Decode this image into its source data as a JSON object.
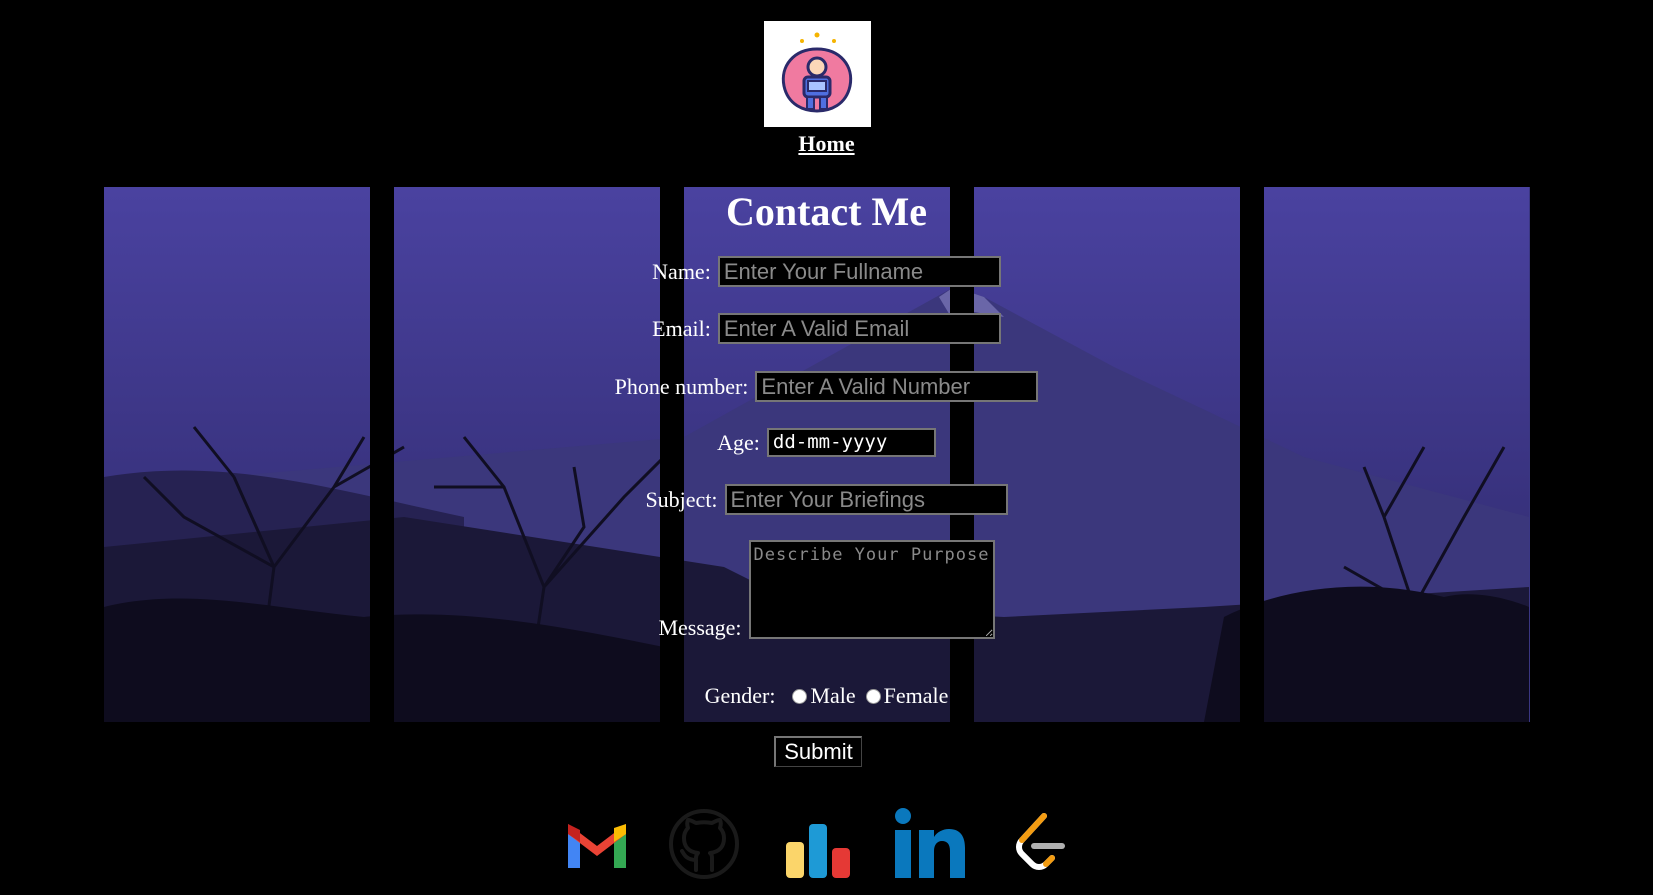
{
  "header": {
    "home_label": "Home",
    "logo_icon": "developer-avatar-icon"
  },
  "form": {
    "title": "Contact Me",
    "name_label": "Name:",
    "name_placeholder": "Enter Your Fullname",
    "email_label": "Email:",
    "email_placeholder": "Enter A Valid Email",
    "phone_label": "Phone number:",
    "phone_placeholder": "Enter A Valid Number",
    "age_label": "Age:",
    "age_value": "dd-mm-yyyy",
    "subject_label": "Subject:",
    "subject_placeholder": "Enter Your Briefings",
    "message_label": "Message:",
    "message_placeholder": "Describe Your Purpose",
    "gender_label": "Gender:",
    "gender_options": [
      "Male",
      "Female"
    ],
    "submit_label": "Submit"
  },
  "social": [
    {
      "icon": "gmail-icon"
    },
    {
      "icon": "github-icon"
    },
    {
      "icon": "analytics-icon"
    },
    {
      "icon": "linkedin-icon"
    },
    {
      "icon": "leetcode-icon"
    }
  ],
  "colors": {
    "background": "#000000",
    "sky": "#3a3682",
    "input_border": "#767676"
  }
}
